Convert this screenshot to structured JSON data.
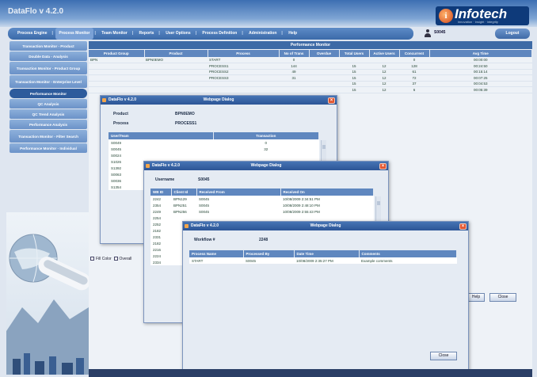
{
  "app": {
    "title": "DataFlo v 4.2.0"
  },
  "logo": {
    "glyph": "i",
    "name": "Infotech",
    "tagline": "innovation · insight · integrity"
  },
  "menu": {
    "items": [
      "Process Engine",
      "Process Monitor",
      "Team Monitor",
      "Reports",
      "User Options",
      "Process Definition",
      "Administration",
      "Help"
    ]
  },
  "user": {
    "name": "S0045",
    "logout": "Logout"
  },
  "sidebar": {
    "items": [
      "Transaction Monitor - Product",
      "Double Data - Analysis",
      "Transaction Monitor - Product Group",
      "Transaction Monitor - Enterprise Level",
      "Performance Monitor",
      "QC Analysis",
      "QC Trend Analysis",
      "Performance Analysis",
      "Transaction Monitor - Filter Search",
      "Performance Monitor - Individual"
    ]
  },
  "perf": {
    "title": "Performance Monitor",
    "columns": [
      "Product Group",
      "Product",
      "Process",
      "No of Trans",
      "Overdue",
      "Total Users",
      "Active Users",
      "Concurrent",
      "Avg Time"
    ],
    "rows": [
      [
        "BPN",
        "BPN0EMO",
        "START",
        "0",
        "",
        "",
        "",
        "0",
        "00:00:00"
      ],
      [
        "",
        "",
        "PROCESS1",
        "144",
        "",
        "15",
        "12",
        "128",
        "00:24:50"
      ],
      [
        "",
        "",
        "PROCESS2",
        "49",
        "",
        "15",
        "12",
        "61",
        "00:15:14"
      ],
      [
        "",
        "",
        "PROCESS3",
        "31",
        "",
        "15",
        "12",
        "72",
        "00:07:25"
      ],
      [
        "",
        "",
        "",
        "",
        "",
        "15",
        "12",
        "37",
        "00:04:53"
      ],
      [
        "",
        "",
        "",
        "",
        "",
        "15",
        "12",
        "6",
        "00:05:39"
      ]
    ],
    "checks": [
      "Fill Color",
      "Overall"
    ],
    "help": "Help",
    "close": "Close"
  },
  "dialog1": {
    "title": "DataFlo v 4.2.0",
    "heading": "Webpage Dialog",
    "product_label": "Product",
    "product": "BPN0EMO",
    "process_label": "Process",
    "process": "PROCESS1",
    "columns": [
      "User/Team",
      "Transaction"
    ],
    "rows": [
      [
        "S0049",
        "0"
      ],
      [
        "S0045",
        "32"
      ],
      [
        "S0024",
        ""
      ],
      [
        "S1026",
        ""
      ],
      [
        "S1392",
        ""
      ],
      [
        "S0063",
        ""
      ],
      [
        "S0036",
        ""
      ],
      [
        "S1354",
        ""
      ]
    ]
  },
  "dialog2": {
    "title": "DataFlo v 4.2.0",
    "heading": "Webpage Dialog",
    "user_label": "Username",
    "user": "S0045",
    "columns": [
      "WB ID",
      "Client Id",
      "Received From",
      "Received On"
    ],
    "rows": [
      [
        "2242",
        "BPN129",
        "S0045",
        "10/08/2009 2:34:51 PM"
      ],
      [
        "2354",
        "BPN251",
        "S0045",
        "10/08/2009 2:48:10 PM"
      ],
      [
        "2249",
        "BPN256",
        "S0045",
        "10/08/2009 2:55:43 PM"
      ],
      [
        "2254",
        "",
        "",
        ""
      ],
      [
        "2252",
        "",
        "",
        ""
      ],
      [
        "2182",
        "",
        "",
        ""
      ],
      [
        "2331",
        "",
        "",
        ""
      ],
      [
        "2182",
        "",
        "",
        ""
      ],
      [
        "2216",
        "",
        "",
        ""
      ],
      [
        "2224",
        "",
        "",
        ""
      ],
      [
        "2334",
        "",
        "",
        ""
      ]
    ]
  },
  "dialog3": {
    "title": "DataFlo v 4.2.0",
    "heading": "Webpage Dialog",
    "workflow_label": "Workflow #",
    "workflow": "2248",
    "columns": [
      "Process Name",
      "Processed By",
      "Date Time",
      "Comments"
    ],
    "rows": [
      [
        "START",
        "S0045",
        "10/08/2009 2:35:27 PM",
        "Example comments"
      ]
    ],
    "close": "Close"
  }
}
